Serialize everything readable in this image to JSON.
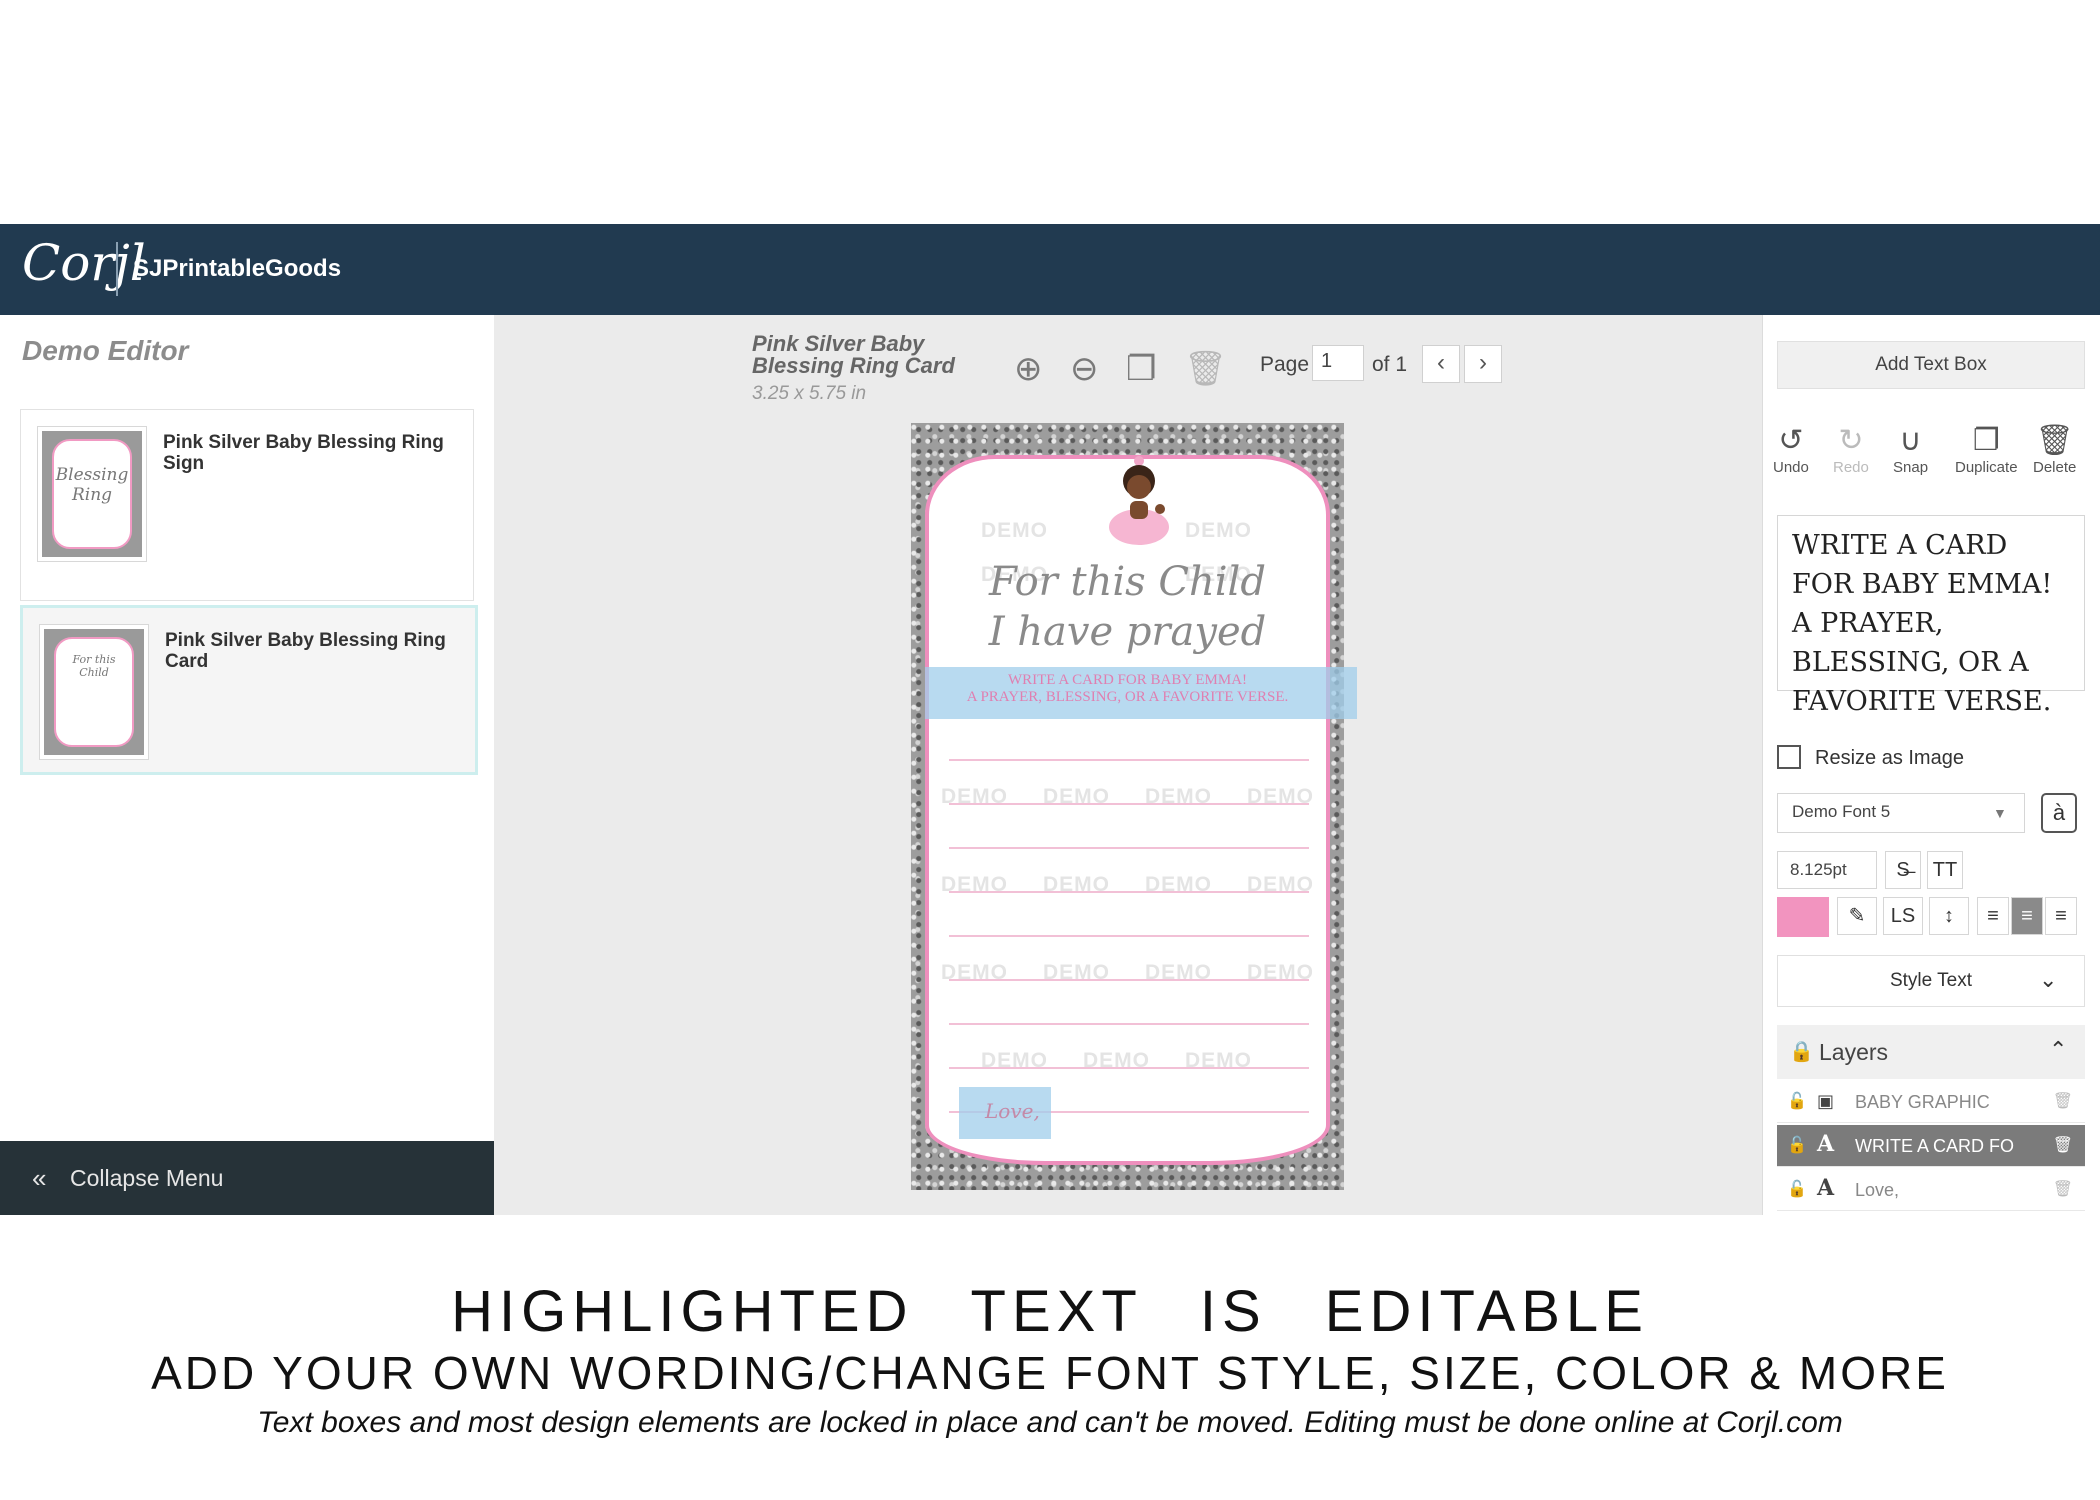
{
  "header": {
    "logo": "Corjl",
    "shop_name": "SJPrintableGoods"
  },
  "left_panel": {
    "title": "Demo Editor",
    "templates": [
      {
        "label": "Pink Silver Baby Blessing Ring Sign",
        "thumb_text": "Blessing Ring"
      },
      {
        "label": "Pink Silver Baby Blessing Ring Card",
        "thumb_text": "For this Child"
      }
    ],
    "collapse_label": "Collapse Menu"
  },
  "canvas_toolbar": {
    "doc_title": "Pink Silver Baby Blessing Ring Card",
    "doc_size": "3.25 x 5.75 in",
    "page_label": "Page",
    "page_value": "1",
    "page_of": "of 1"
  },
  "card": {
    "watermark": "DEMO",
    "script_line1": "For this Child",
    "script_line2": "I have prayed",
    "text_line1": "WRITE A CARD FOR BABY EMMA!",
    "text_line2": "A PRAYER, BLESSING, OR A FAVORITE VERSE.",
    "love_text": "Love,",
    "colors": {
      "border_pink": "#ee8fbd",
      "text_pink": "#e07fb0",
      "highlight": "#a0cdeb",
      "glitter": "#9d9d9d"
    }
  },
  "right_panel": {
    "add_text_box": "Add Text Box",
    "tools": {
      "undo": "Undo",
      "redo": "Redo",
      "snap": "Snap",
      "duplicate": "Duplicate",
      "delete": "Delete"
    },
    "preview_text": "WRITE A CARD FOR BABY EMMA! A PRAYER, BLESSING, OR A FAVORITE VERSE.",
    "resize_label": "Resize as Image",
    "font": "Demo Font 5",
    "font_size": "8.125pt",
    "text_color": "#f294bf",
    "style_text": "Style Text",
    "layers_label": "Layers",
    "layers": [
      {
        "name": "BABY GRAPHIC",
        "type": "image"
      },
      {
        "name": "WRITE A CARD FO",
        "type": "text",
        "selected": true
      },
      {
        "name": "Love,",
        "type": "text"
      }
    ]
  },
  "captions": {
    "line1": "HIGHLIGHTED TEXT IS EDITABLE",
    "line2": "ADD YOUR OWN WORDING/CHANGE FONT STYLE, SIZE, COLOR & MORE",
    "line3": "Text boxes and most design elements are locked in place and can't be moved. Editing must be done online at Corjl.com"
  }
}
